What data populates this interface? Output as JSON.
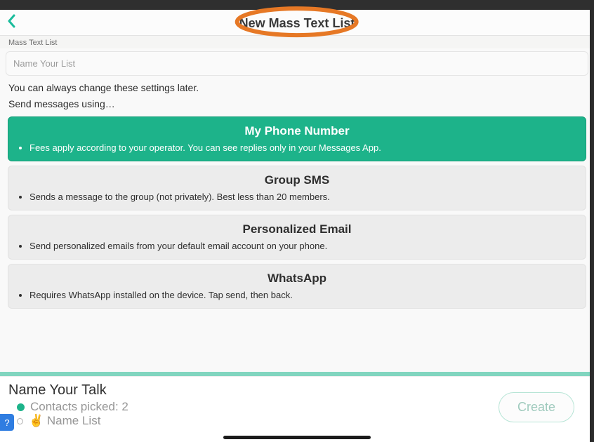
{
  "header": {
    "title": "New Mass Text List"
  },
  "form": {
    "label": "Mass Text List",
    "placeholder": "Name Your List"
  },
  "hint_line1": "You can always change these settings later.",
  "hint_line2": "Send messages using…",
  "options": {
    "my_phone": {
      "title": "My Phone Number",
      "desc": "Fees apply according to your operator. You can see replies only in your Messages App."
    },
    "group_sms": {
      "title": "Group SMS",
      "desc": "Sends a message to the group (not privately). Best less than 20 members."
    },
    "email": {
      "title": "Personalized Email",
      "desc": "Send personalized emails from your default email account on your phone."
    },
    "whatsapp": {
      "title": "WhatsApp",
      "desc": "Requires WhatsApp installed on the device. Tap send, then back."
    }
  },
  "bottom": {
    "talk_title": "Name Your Talk",
    "contacts_line": "Contacts picked: 2",
    "name_list_line": "✌️ Name List",
    "create_label": "Create"
  },
  "help_glyph": "?"
}
